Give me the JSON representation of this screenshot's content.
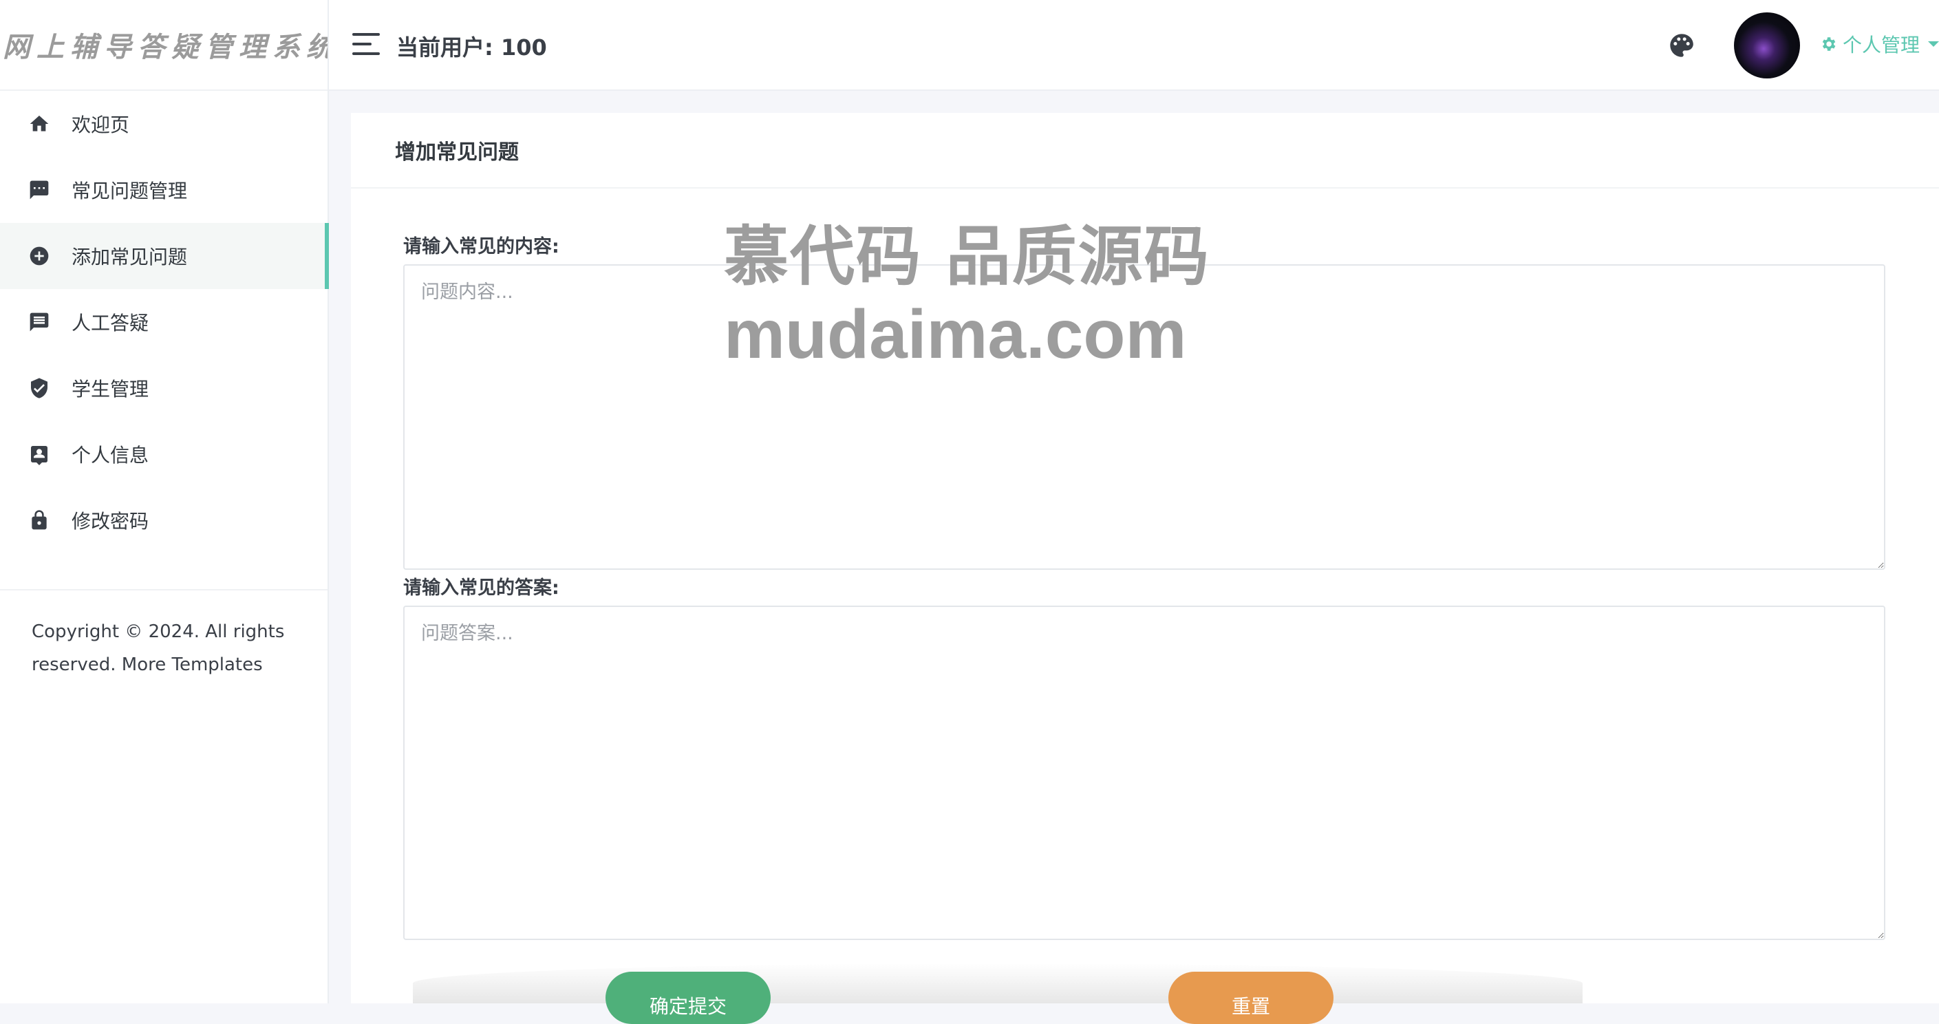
{
  "sidebar": {
    "brand": "网上辅导答疑管理系统",
    "items": [
      {
        "label": "欢迎页",
        "icon": "home-icon"
      },
      {
        "label": "常见问题管理",
        "icon": "message-icon"
      },
      {
        "label": "添加常见问题",
        "icon": "plus-circle-icon",
        "active": true
      },
      {
        "label": "人工答疑",
        "icon": "comment-icon"
      },
      {
        "label": "学生管理",
        "icon": "shield-check-icon"
      },
      {
        "label": "个人信息",
        "icon": "contact-card-icon"
      },
      {
        "label": "修改密码",
        "icon": "lock-icon"
      }
    ],
    "copyright_line1": "Copyright © 2024. All rights",
    "copyright_line2": "reserved. More Templates"
  },
  "header": {
    "current_user": "当前用户: 100",
    "user_menu_label": "个人管理",
    "icons": [
      "menu-icon",
      "palette-icon",
      "gear-icon",
      "caret-down-icon"
    ]
  },
  "form": {
    "title": "增加常见问题",
    "content_label": "请输入常见的内容:",
    "content_placeholder": "问题内容...",
    "answer_label": "请输入常见的答案:",
    "answer_placeholder": "问题答案...",
    "submit_label": "确定提交",
    "reset_label": "重置"
  },
  "watermark": {
    "line1": "慕代码 品质源码",
    "line2": "mudaima.com"
  },
  "colors": {
    "accent": "#5cc7b0",
    "submit": "#4fb07a",
    "reset": "#e79a4f",
    "page_bg": "#f5f6fa"
  }
}
